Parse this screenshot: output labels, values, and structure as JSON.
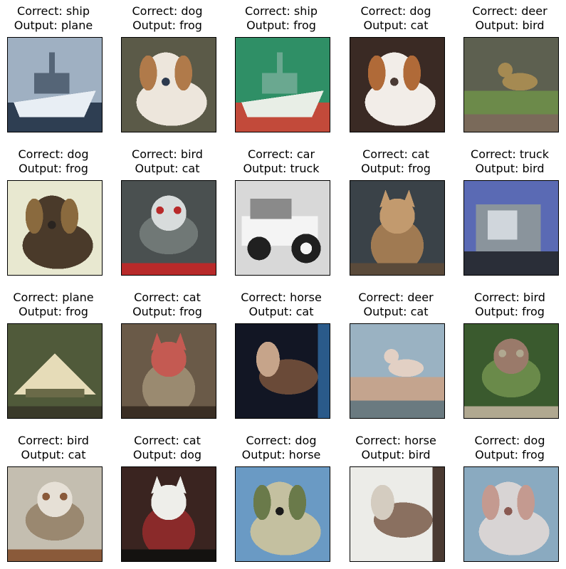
{
  "samples": [
    {
      "correct": "Correct: ship",
      "output": "Output: plane",
      "subject": "ship",
      "palette": {
        "bg": "#9fb0c2",
        "mid": "#556577",
        "fg": "#e8eef4",
        "accent": "#2e3e52"
      }
    },
    {
      "correct": "Correct: dog",
      "output": "Output: frog",
      "subject": "dog",
      "palette": {
        "bg": "#5b5a48",
        "mid": "#b07a4a",
        "fg": "#ede6dc",
        "accent": "#2d3a4e"
      }
    },
    {
      "correct": "Correct: ship",
      "output": "Output: frog",
      "subject": "ship",
      "palette": {
        "bg": "#2f8f66",
        "mid": "#6aa890",
        "fg": "#e8eee6",
        "accent": "#c24a3a"
      }
    },
    {
      "correct": "Correct: dog",
      "output": "Output: cat",
      "subject": "dog",
      "palette": {
        "bg": "#3a2a24",
        "mid": "#b06a38",
        "fg": "#f2ede8",
        "accent": "#4a3a34"
      }
    },
    {
      "correct": "Correct: deer",
      "output": "Output: bird",
      "subject": "deer",
      "palette": {
        "bg": "#5d6050",
        "mid": "#6c8a4a",
        "fg": "#a58a52",
        "accent": "#7a6a5a"
      }
    },
    {
      "correct": "Correct: dog",
      "output": "Output: frog",
      "subject": "dog",
      "palette": {
        "bg": "#e8e8d0",
        "mid": "#8a6a3e",
        "fg": "#4a3a2a",
        "accent": "#2a2420"
      }
    },
    {
      "correct": "Correct: bird",
      "output": "Output: cat",
      "subject": "bird",
      "palette": {
        "bg": "#4a5050",
        "mid": "#707876",
        "fg": "#d8dcdc",
        "accent": "#b82a2a"
      }
    },
    {
      "correct": "Correct: car",
      "output": "Output: truck",
      "subject": "car",
      "palette": {
        "bg": "#d8d8d8",
        "mid": "#8a8a8a",
        "fg": "#f4f4f4",
        "accent": "#202020"
      }
    },
    {
      "correct": "Correct: cat",
      "output": "Output: frog",
      "subject": "cat",
      "palette": {
        "bg": "#3a4248",
        "mid": "#a07a52",
        "fg": "#c29a6e",
        "accent": "#5a4a3a"
      }
    },
    {
      "correct": "Correct: truck",
      "output": "Output: bird",
      "subject": "truck",
      "palette": {
        "bg": "#5a6ab4",
        "mid": "#8a949c",
        "fg": "#d0d6dc",
        "accent": "#2a2e38"
      }
    },
    {
      "correct": "Correct: plane",
      "output": "Output: frog",
      "subject": "plane",
      "palette": {
        "bg": "#505a3a",
        "mid": "#6a6a48",
        "fg": "#e6dcb8",
        "accent": "#3a3a2a"
      }
    },
    {
      "correct": "Correct: cat",
      "output": "Output: frog",
      "subject": "cat",
      "palette": {
        "bg": "#6a5a48",
        "mid": "#9a8a70",
        "fg": "#c45a52",
        "accent": "#3a2e24"
      }
    },
    {
      "correct": "Correct: horse",
      "output": "Output: cat",
      "subject": "horse",
      "palette": {
        "bg": "#121624",
        "mid": "#6a4a38",
        "fg": "#c6a48a",
        "accent": "#2a5a8a"
      }
    },
    {
      "correct": "Correct: deer",
      "output": "Output: cat",
      "subject": "deer",
      "palette": {
        "bg": "#9ab2c2",
        "mid": "#c4a48e",
        "fg": "#e2d0c4",
        "accent": "#6a7a80"
      }
    },
    {
      "correct": "Correct: bird",
      "output": "Output: frog",
      "subject": "bird",
      "palette": {
        "bg": "#3a5a2e",
        "mid": "#6a8a4a",
        "fg": "#9a7a6a",
        "accent": "#b0a890"
      }
    },
    {
      "correct": "Correct: bird",
      "output": "Output: cat",
      "subject": "bird",
      "palette": {
        "bg": "#c4beb0",
        "mid": "#9a8870",
        "fg": "#e6e0d6",
        "accent": "#8a5a3a"
      }
    },
    {
      "correct": "Correct: cat",
      "output": "Output: dog",
      "subject": "cat",
      "palette": {
        "bg": "#3a2420",
        "mid": "#8a2a2a",
        "fg": "#eeeeea",
        "accent": "#141210"
      }
    },
    {
      "correct": "Correct: dog",
      "output": "Output: horse",
      "subject": "dog",
      "palette": {
        "bg": "#6a9ac4",
        "mid": "#6a7a4a",
        "fg": "#c4c0a0",
        "accent": "#1a1a1a"
      }
    },
    {
      "correct": "Correct: horse",
      "output": "Output: bird",
      "subject": "horse",
      "palette": {
        "bg": "#ecece8",
        "mid": "#8a7060",
        "fg": "#d4ccc0",
        "accent": "#4a3a32"
      }
    },
    {
      "correct": "Correct: dog",
      "output": "Output: frog",
      "subject": "dog",
      "palette": {
        "bg": "#8aaac0",
        "mid": "#c49a90",
        "fg": "#d8d4d4",
        "accent": "#8a5a52"
      }
    }
  ]
}
